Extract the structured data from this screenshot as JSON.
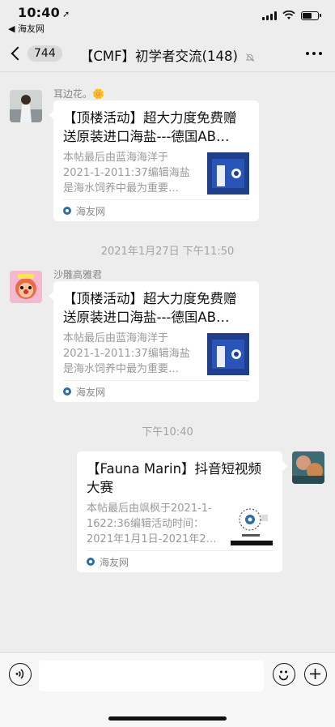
{
  "status_bar": {
    "time": "10:40",
    "back_to_app": "◀ 海友网"
  },
  "nav": {
    "back_count": "744",
    "title": "【CMF】初学者交流(148)"
  },
  "messages": [
    {
      "sender": "耳边花。🌼",
      "card": {
        "title_1": "【顶楼活动】超大力度免费赠",
        "title_2": "送原装进口海盐---德国AB…",
        "desc_1": "本帖最后由蓝海海洋于",
        "desc_2": "2021-1-2011:37编辑海盐",
        "desc_3": "是海水饲养中最为重要…",
        "source": "海友网"
      }
    },
    {
      "timestamp": "2021年1月27日 下午11:50",
      "sender": "沙雕高雅君",
      "card": {
        "title_1": "【顶楼活动】超大力度免费赠",
        "title_2": "送原装进口海盐---德国AB…",
        "desc_1": "本帖最后由蓝海海洋于",
        "desc_2": "2021-1-2011:37编辑海盐",
        "desc_3": "是海水饲养中最为重要…",
        "source": "海友网"
      }
    },
    {
      "timestamp": "下午10:40",
      "card": {
        "title_1": "【Fauna Marin】抖音短视频",
        "title_2": "大赛",
        "desc_1": "本帖最后由飒枫于2021-1-",
        "desc_2": "1622:36编辑活动时间：",
        "desc_3": "2021年1月1日-2021年2…",
        "source": "海友网"
      }
    }
  ],
  "icons": {
    "voice": "voice-icon",
    "emoji": "emoji-icon",
    "add": "add-icon"
  }
}
